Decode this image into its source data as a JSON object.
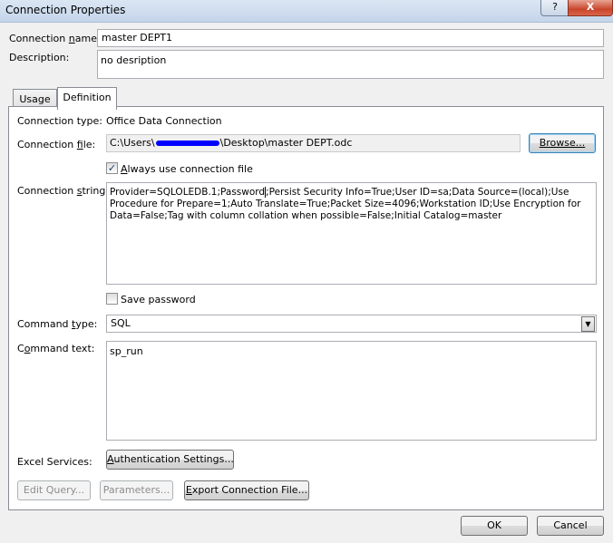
{
  "window": {
    "title": "Connection Properties",
    "help_label": "?",
    "close_label": "X"
  },
  "connection_name": {
    "label_pre": "Connection ",
    "label_u": "n",
    "label_post": "ame:",
    "value": "master DEPT1"
  },
  "description": {
    "label": "Description:",
    "value": "no desription"
  },
  "tabs": [
    {
      "label": "Usage",
      "active": false
    },
    {
      "label": "Definition",
      "active": true
    }
  ],
  "definition": {
    "connection_type": {
      "label": "Connection type:",
      "value": "Office Data Connection"
    },
    "connection_file": {
      "label_pre": "Connection ",
      "label_u": "f",
      "label_post": "ile:",
      "value_pre": "C:\\Users\\",
      "value_post": "\\Desktop\\master DEPT.odc",
      "browse_label": "Browse..."
    },
    "always_use_file": {
      "label_u": "A",
      "label_post": "lways use connection file",
      "checked": true,
      "check_glyph": "✓"
    },
    "connection_string": {
      "label_pre": "Connection ",
      "label_u": "s",
      "label_post": "tring:",
      "value_pre": "Provider=SQLOLEDB.1;Password",
      "value_post": ";Persist Security Info=True;User ID=sa;Data Source=(local);Use Procedure for Prepare=1;Auto Translate=True;Packet Size=4096;Workstation ID;Use Encryption for Data=False;Tag with column collation when possible=False;Initial Catalog=master"
    },
    "save_password": {
      "label": "Save password",
      "checked": false
    },
    "command_type": {
      "label_pre": "Command ",
      "label_u": "t",
      "label_post": "ype:",
      "value": "SQL",
      "arrow": "▼"
    },
    "command_text": {
      "label_pre": "C",
      "label_u": "o",
      "label_post": "mmand text:",
      "value": "sp_run"
    },
    "excel_services": {
      "label": "Excel Services:",
      "button_u": "A",
      "button_post": "uthentication Settings..."
    },
    "buttons": {
      "edit_query": "Edit Query...",
      "parameters": "Parameters...",
      "export_u": "E",
      "export_post": "xport Connection File..."
    }
  },
  "footer": {
    "ok": "OK",
    "cancel": "Cancel"
  }
}
